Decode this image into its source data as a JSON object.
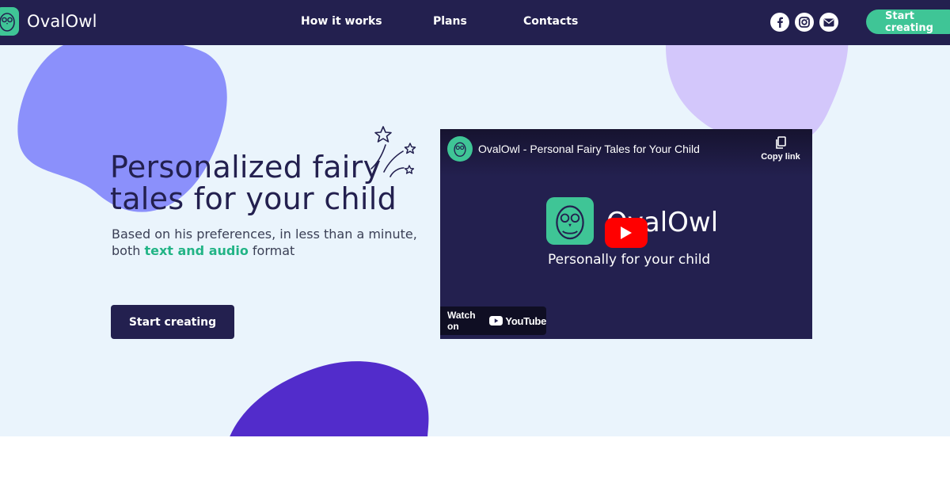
{
  "brand": {
    "name": "OvalOwl",
    "logo_icon": "owl-icon"
  },
  "nav": {
    "links": [
      "How it works",
      "Plans",
      "Contacts"
    ],
    "social_icons": [
      "facebook-icon",
      "instagram-icon",
      "mail-icon"
    ],
    "cta_label": "Start creating"
  },
  "hero": {
    "headline_line1": "Personalized fairy",
    "headline_line2": "tales for your child",
    "sub_part1": "Based on his preferences, in less than a minute,",
    "sub_part2": "both ",
    "sub_highlight": "text and audio",
    "sub_part3": " format",
    "cta_label": "Start creating"
  },
  "video": {
    "title": "OvalOwl - Personal Fairy Tales for Your Child",
    "copy_link": "Copy link",
    "brand": "OvalOwl",
    "tagline": "Personally for your child",
    "watch_on": "Watch on",
    "youtube": "YouTube"
  },
  "colors": {
    "nav_bg": "#23204f",
    "accent": "#3fc596",
    "hero_bg": "#eaf4fc",
    "blob_blue": "#8b90fb",
    "blob_lilac": "#d3c7fb",
    "blob_violet": "#522ccb"
  }
}
